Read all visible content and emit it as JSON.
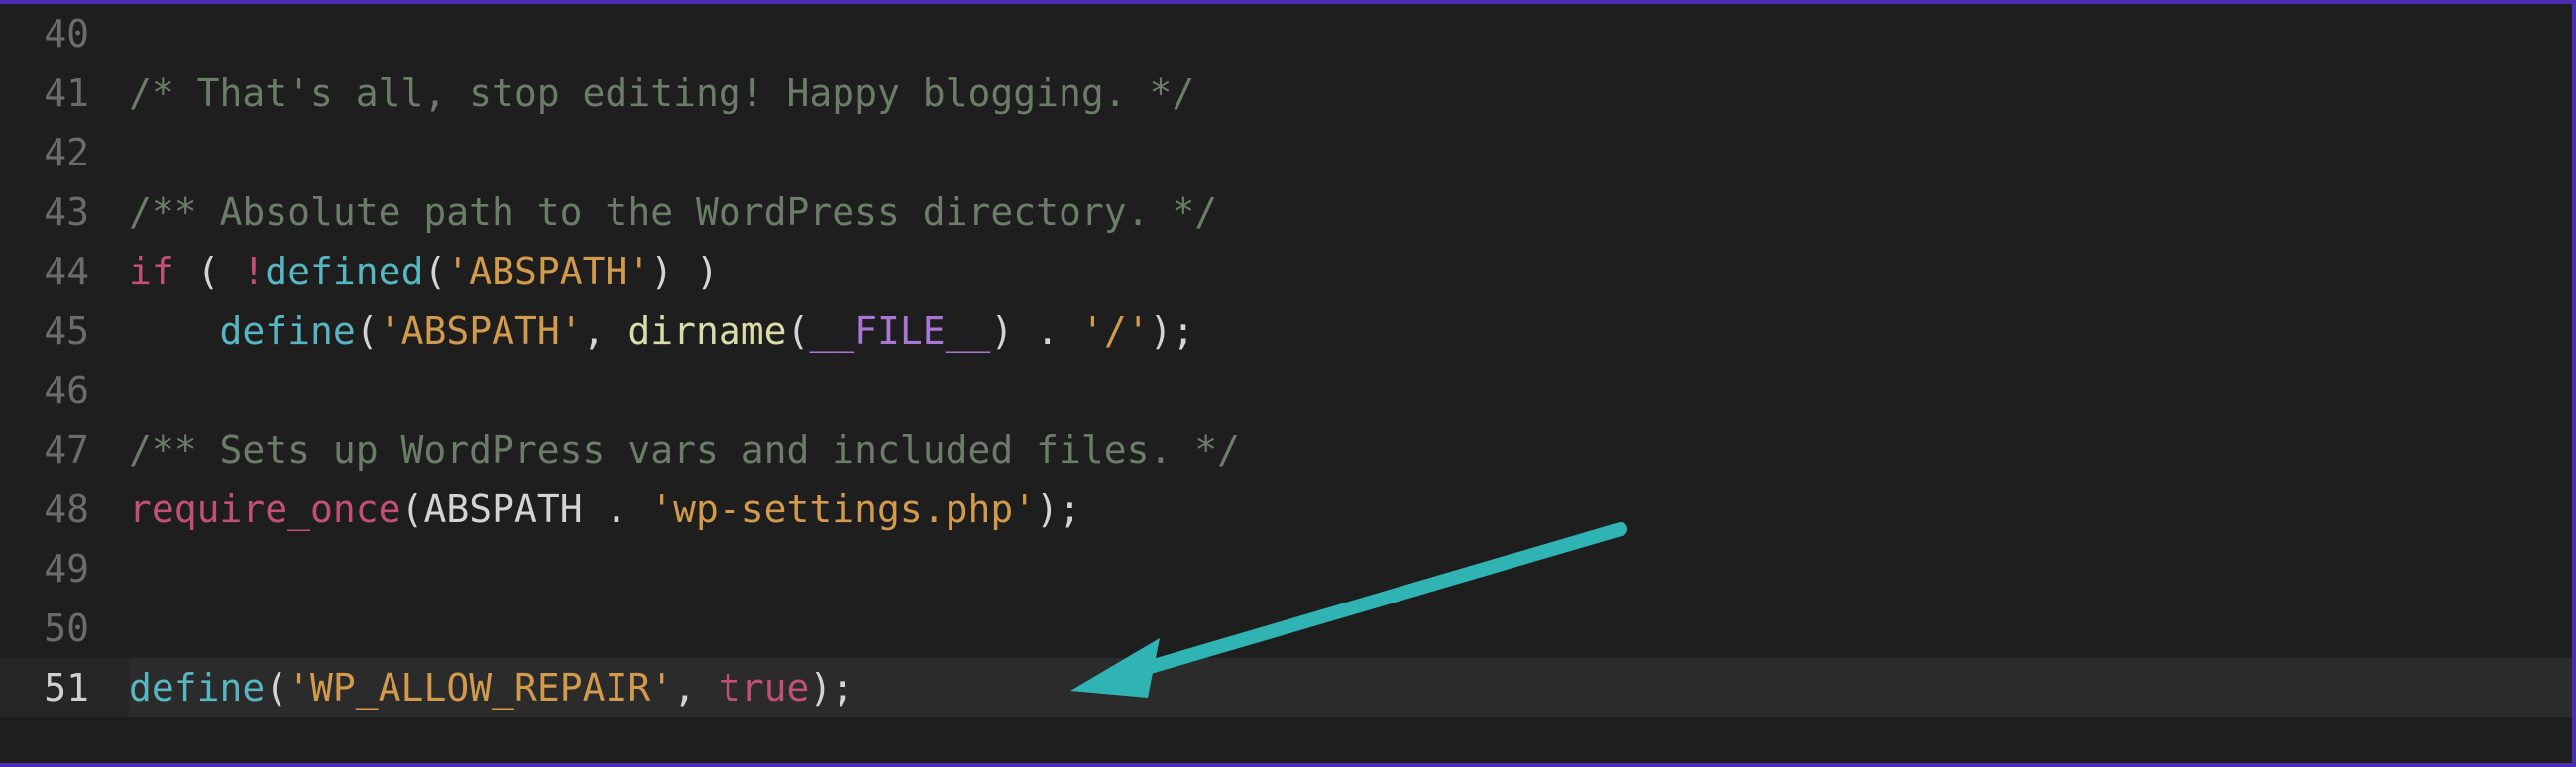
{
  "lines": [
    {
      "num": "40",
      "tokens": []
    },
    {
      "num": "41",
      "tokens": [
        {
          "cls": "tk-comment",
          "t": "/* That's all, stop editing! Happy blogging. */"
        }
      ]
    },
    {
      "num": "42",
      "tokens": []
    },
    {
      "num": "43",
      "tokens": [
        {
          "cls": "tk-comment",
          "t": "/** Absolute path to the WordPress directory. */"
        }
      ]
    },
    {
      "num": "44",
      "tokens": [
        {
          "cls": "tk-keyword",
          "t": "if"
        },
        {
          "cls": "tk-plain",
          "t": " ( "
        },
        {
          "cls": "tk-not",
          "t": "!"
        },
        {
          "cls": "tk-func",
          "t": "defined"
        },
        {
          "cls": "tk-punct",
          "t": "("
        },
        {
          "cls": "tk-string",
          "t": "'ABSPATH'"
        },
        {
          "cls": "tk-punct",
          "t": ") )"
        }
      ]
    },
    {
      "num": "45",
      "tokens": [
        {
          "cls": "tk-plain",
          "t": "    "
        },
        {
          "cls": "tk-func",
          "t": "define"
        },
        {
          "cls": "tk-punct",
          "t": "("
        },
        {
          "cls": "tk-string",
          "t": "'ABSPATH'"
        },
        {
          "cls": "tk-punct",
          "t": ", "
        },
        {
          "cls": "tk-func2",
          "t": "dirname"
        },
        {
          "cls": "tk-punct",
          "t": "("
        },
        {
          "cls": "tk-const",
          "t": "__FILE__"
        },
        {
          "cls": "tk-punct",
          "t": ") . "
        },
        {
          "cls": "tk-string",
          "t": "'/'"
        },
        {
          "cls": "tk-punct",
          "t": ");"
        }
      ]
    },
    {
      "num": "46",
      "tokens": []
    },
    {
      "num": "47",
      "tokens": [
        {
          "cls": "tk-comment",
          "t": "/** Sets up WordPress vars and included files. */"
        }
      ]
    },
    {
      "num": "48",
      "tokens": [
        {
          "cls": "tk-keyword",
          "t": "require_once"
        },
        {
          "cls": "tk-punct",
          "t": "("
        },
        {
          "cls": "tk-ident",
          "t": "ABSPATH"
        },
        {
          "cls": "tk-punct",
          "t": " . "
        },
        {
          "cls": "tk-string",
          "t": "'wp-settings.php'"
        },
        {
          "cls": "tk-punct",
          "t": ");"
        }
      ]
    },
    {
      "num": "49",
      "tokens": []
    },
    {
      "num": "50",
      "tokens": []
    },
    {
      "num": "51",
      "current": true,
      "tokens": [
        {
          "cls": "tk-func",
          "t": "define"
        },
        {
          "cls": "tk-punct",
          "t": "("
        },
        {
          "cls": "tk-string",
          "t": "'WP_ALLOW_REPAIR'"
        },
        {
          "cls": "tk-punct",
          "t": ", "
        },
        {
          "cls": "tk-true",
          "t": "true"
        },
        {
          "cls": "tk-punct",
          "t": ");"
        }
      ]
    }
  ]
}
